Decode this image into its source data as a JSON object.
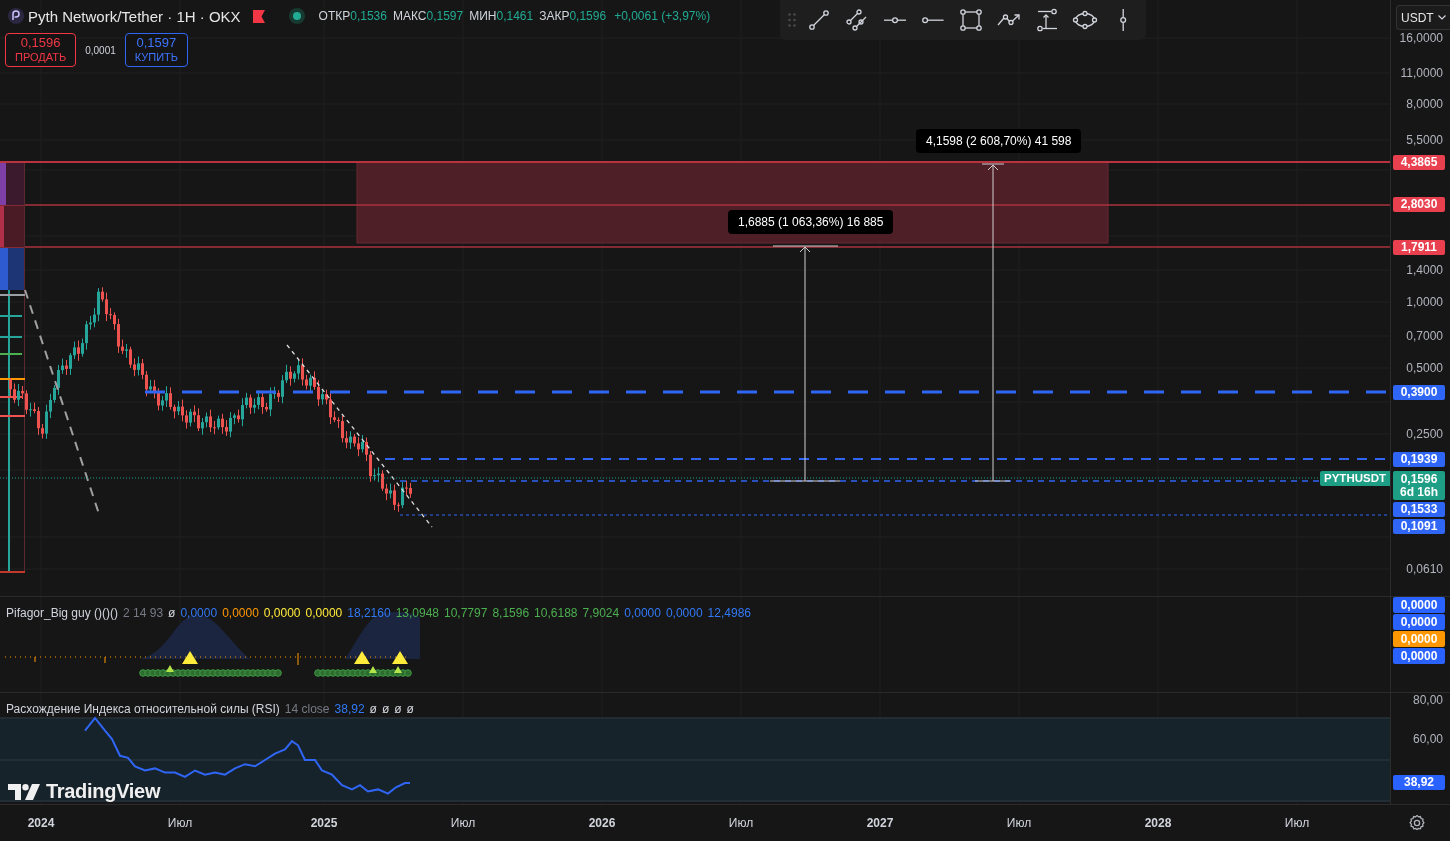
{
  "header": {
    "title": "Pyth Network/Tether · 1H · OKX",
    "flagged": true,
    "market_open": true,
    "ohlc": [
      {
        "label": "ОТКР",
        "value": "0,1536"
      },
      {
        "label": "МАКС",
        "value": "0,1597"
      },
      {
        "label": "МИН",
        "value": "0,1461"
      },
      {
        "label": "ЗАКР",
        "value": "0,1596"
      }
    ],
    "change": "+0,0061 (+3,97%)"
  },
  "trade": {
    "sell": {
      "price": "0,1596",
      "label": "ПРОДАТЬ"
    },
    "spread": "0,0001",
    "buy": {
      "price": "0,1597",
      "label": "КУПИТЬ"
    }
  },
  "toolbar": {
    "tools": [
      {
        "kind": "trend-line"
      },
      {
        "kind": "parallel-channel"
      },
      {
        "kind": "horizontal-line"
      },
      {
        "kind": "horizontal-ray"
      },
      {
        "kind": "rectangle"
      },
      {
        "kind": "path"
      },
      {
        "kind": "price-range"
      },
      {
        "kind": "ellipse"
      },
      {
        "kind": "vertical-line"
      }
    ]
  },
  "currency": "USDT",
  "measurements": [
    "1,6885 (1 063,36%) 16 885",
    "4,1598 (2 608,70%) 41 598"
  ],
  "symbol_label": "PYTHUSDT",
  "price_axis": {
    "ticks": [
      "16,0000",
      "11,0000",
      "8,0000",
      "5,5000",
      "1,4000",
      "1,0000",
      "0,7000",
      "0,5000",
      "0,2500",
      "0,0610"
    ],
    "badges": [
      {
        "text": "4,3865",
        "color": "#e8404f"
      },
      {
        "text": "2,8030",
        "color": "#e8404f"
      },
      {
        "text": "1,7911",
        "color": "#e8404f"
      },
      {
        "text": "0,3900",
        "color": "#2f66f6"
      },
      {
        "text": "0,1939",
        "color": "#2f66f6"
      },
      {
        "text": "0,1596",
        "sub": "6d 16h",
        "color": "#1f9e86"
      },
      {
        "text": "0,1533",
        "color": "#2f66f6"
      },
      {
        "text": "0,1091",
        "color": "#2f66f6"
      }
    ]
  },
  "indicator": {
    "name": "Pifagor_Big guy ()()()",
    "params": "2 14 93",
    "symbol": "ø",
    "values": [
      {
        "text": "0,0000",
        "color": "#3179f5"
      },
      {
        "text": "0,0000",
        "color": "#ff9800"
      },
      {
        "text": "0,0000",
        "color": "#ffeb3b"
      },
      {
        "text": "0,0000",
        "color": "#ffeb3b"
      },
      {
        "text": "18,2160",
        "color": "#3179f5"
      },
      {
        "text": "13,0948",
        "color": "#4caf50"
      },
      {
        "text": "10,7797",
        "color": "#4caf50"
      },
      {
        "text": "8,1596",
        "color": "#4caf50"
      },
      {
        "text": "10,6188",
        "color": "#4caf50"
      },
      {
        "text": "7,9024",
        "color": "#4caf50"
      },
      {
        "text": "0,0000",
        "color": "#3179f5"
      },
      {
        "text": "0,0000",
        "color": "#3179f5"
      },
      {
        "text": "12,4986",
        "color": "#3179f5"
      }
    ],
    "axis_badges": [
      {
        "text": "0,0000",
        "color": "#2962ff"
      },
      {
        "text": "0,0000",
        "color": "#2962ff"
      },
      {
        "text": "0,0000",
        "color": "#ff9800"
      },
      {
        "text": "0,0000",
        "color": "#2962ff"
      }
    ]
  },
  "rsi": {
    "name": "Расхождение Индекса относительной силы (RSI)",
    "params": "14 close",
    "value": "38,92",
    "extras": [
      "ø",
      "ø",
      "ø",
      "ø"
    ],
    "axis_ticks": [
      "80,00",
      "60,00"
    ],
    "axis_badge": {
      "text": "38,92",
      "color": "#2962ff"
    }
  },
  "branding": {
    "text": "TradingView"
  },
  "time_axis": [
    {
      "text": "2024",
      "kind": "year"
    },
    {
      "text": "Июл",
      "kind": "month"
    },
    {
      "text": "2025",
      "kind": "year"
    },
    {
      "text": "Июл",
      "kind": "month"
    },
    {
      "text": "2026",
      "kind": "year"
    },
    {
      "text": "Июл",
      "kind": "month"
    },
    {
      "text": "2027",
      "kind": "year"
    },
    {
      "text": "Июл",
      "kind": "month"
    },
    {
      "text": "2028",
      "kind": "year"
    },
    {
      "text": "Июл",
      "kind": "month"
    }
  ]
}
